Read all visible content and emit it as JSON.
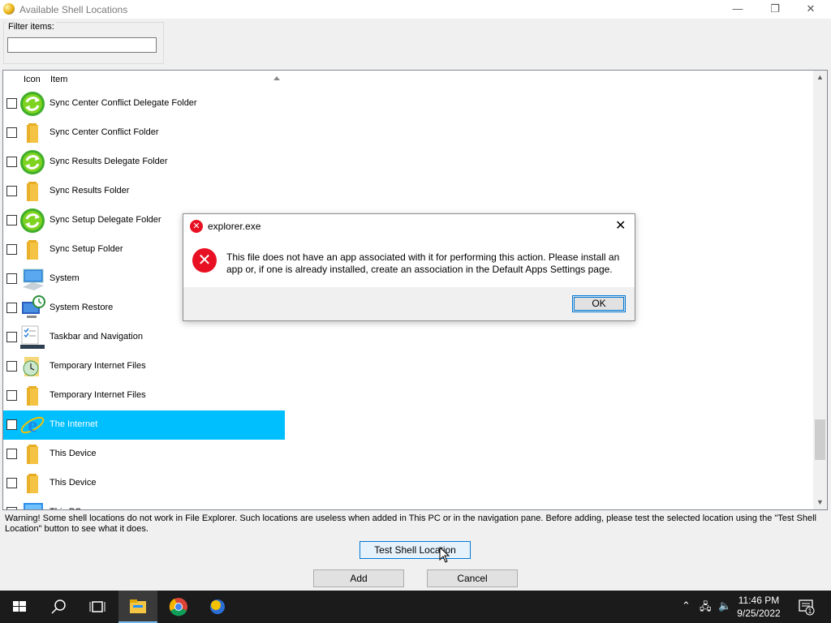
{
  "window": {
    "title": "Available Shell Locations",
    "minimize": "—",
    "maximize": "❐",
    "close": "✕"
  },
  "filter": {
    "label": "Filter items:",
    "value": ""
  },
  "list": {
    "columns": {
      "icon": "Icon",
      "item": "Item"
    },
    "rows": [
      {
        "label": "Sync Center Conflict Delegate Folder",
        "icon": "sync-icon"
      },
      {
        "label": "Sync Center Conflict Folder",
        "icon": "folder-icon"
      },
      {
        "label": "Sync Results Delegate Folder",
        "icon": "sync-icon"
      },
      {
        "label": "Sync Results Folder",
        "icon": "folder-icon"
      },
      {
        "label": "Sync Setup Delegate Folder",
        "icon": "sync-icon"
      },
      {
        "label": "Sync Setup Folder",
        "icon": "folder-icon"
      },
      {
        "label": "System",
        "icon": "system-icon"
      },
      {
        "label": "System Restore",
        "icon": "system-restore-icon"
      },
      {
        "label": "Taskbar and Navigation",
        "icon": "taskbar-icon"
      },
      {
        "label": "Temporary Internet Files",
        "icon": "temp-internet-icon"
      },
      {
        "label": "Temporary Internet Files",
        "icon": "folder-icon"
      },
      {
        "label": "The Internet",
        "icon": "internet-explorer-icon",
        "selected": true
      },
      {
        "label": "This Device",
        "icon": "folder-icon"
      },
      {
        "label": "This Device",
        "icon": "folder-icon"
      },
      {
        "label": "This PC",
        "icon": "this-pc-icon"
      }
    ]
  },
  "warning": "Warning! Some shell locations do not work in File Explorer. Such locations are useless when added in This PC or in the navigation pane. Before adding, please test the selected location using the \"Test Shell Location\" button to see what it does.",
  "buttons": {
    "test": "Test Shell Location",
    "add": "Add",
    "cancel": "Cancel"
  },
  "dialog": {
    "title": "explorer.exe",
    "message": "This file does not have an app associated with it for performing this action. Please install an app or, if one is already installed, create an association in the Default Apps Settings page.",
    "ok": "OK"
  },
  "taskbar": {
    "time": "11:46 PM",
    "date": "9/25/2022",
    "notification_count": "1"
  },
  "colors": {
    "selection": "#00bfff",
    "error_red": "#e81123",
    "taskbar": "#1b1b1b"
  }
}
